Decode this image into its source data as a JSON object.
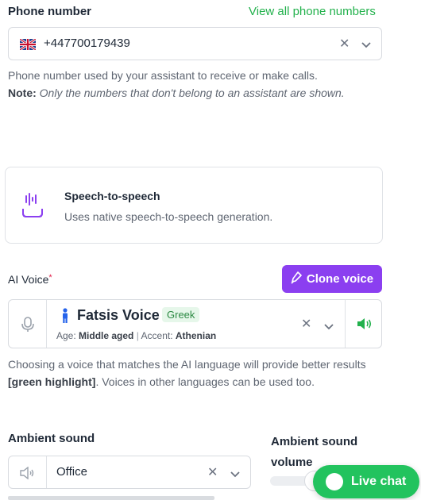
{
  "phone": {
    "label": "Phone number",
    "view_all_link": "View all phone numbers",
    "value": "+447700179439",
    "flag": "uk-flag-icon",
    "help_text": "Phone number used by your assistant to receive or make calls.",
    "note_label": "Note:",
    "note_text": "Only the numbers that don't belong to an assistant are shown."
  },
  "speech_mode": {
    "title": "Speech-to-speech",
    "description": "Uses native speech-to-speech generation.",
    "icon": "speech-icon"
  },
  "ai_voice": {
    "label": "AI Voice",
    "required_mark": "*",
    "clone_button": "Clone voice",
    "voice_name": "Fatsis Voice",
    "language_tag": "Greek",
    "age_label": "Age:",
    "age_value": "Middle aged",
    "accent_label": "Accent:",
    "accent_value": "Athenian",
    "help_text_1": "Choosing a voice that matches the AI language will provide better results ",
    "help_highlight": "[green highlight]",
    "help_text_2": ". Voices in other languages can be used too."
  },
  "ambient": {
    "label": "Ambient sound",
    "value": "Office",
    "volume_label_line1": "Ambient sound",
    "volume_label_line2": "volume"
  },
  "live_chat": {
    "label": "Live chat"
  },
  "colors": {
    "accent_green": "#22b14c",
    "accent_purple": "#8b3ff0",
    "live_chat_green": "#22c35e"
  }
}
